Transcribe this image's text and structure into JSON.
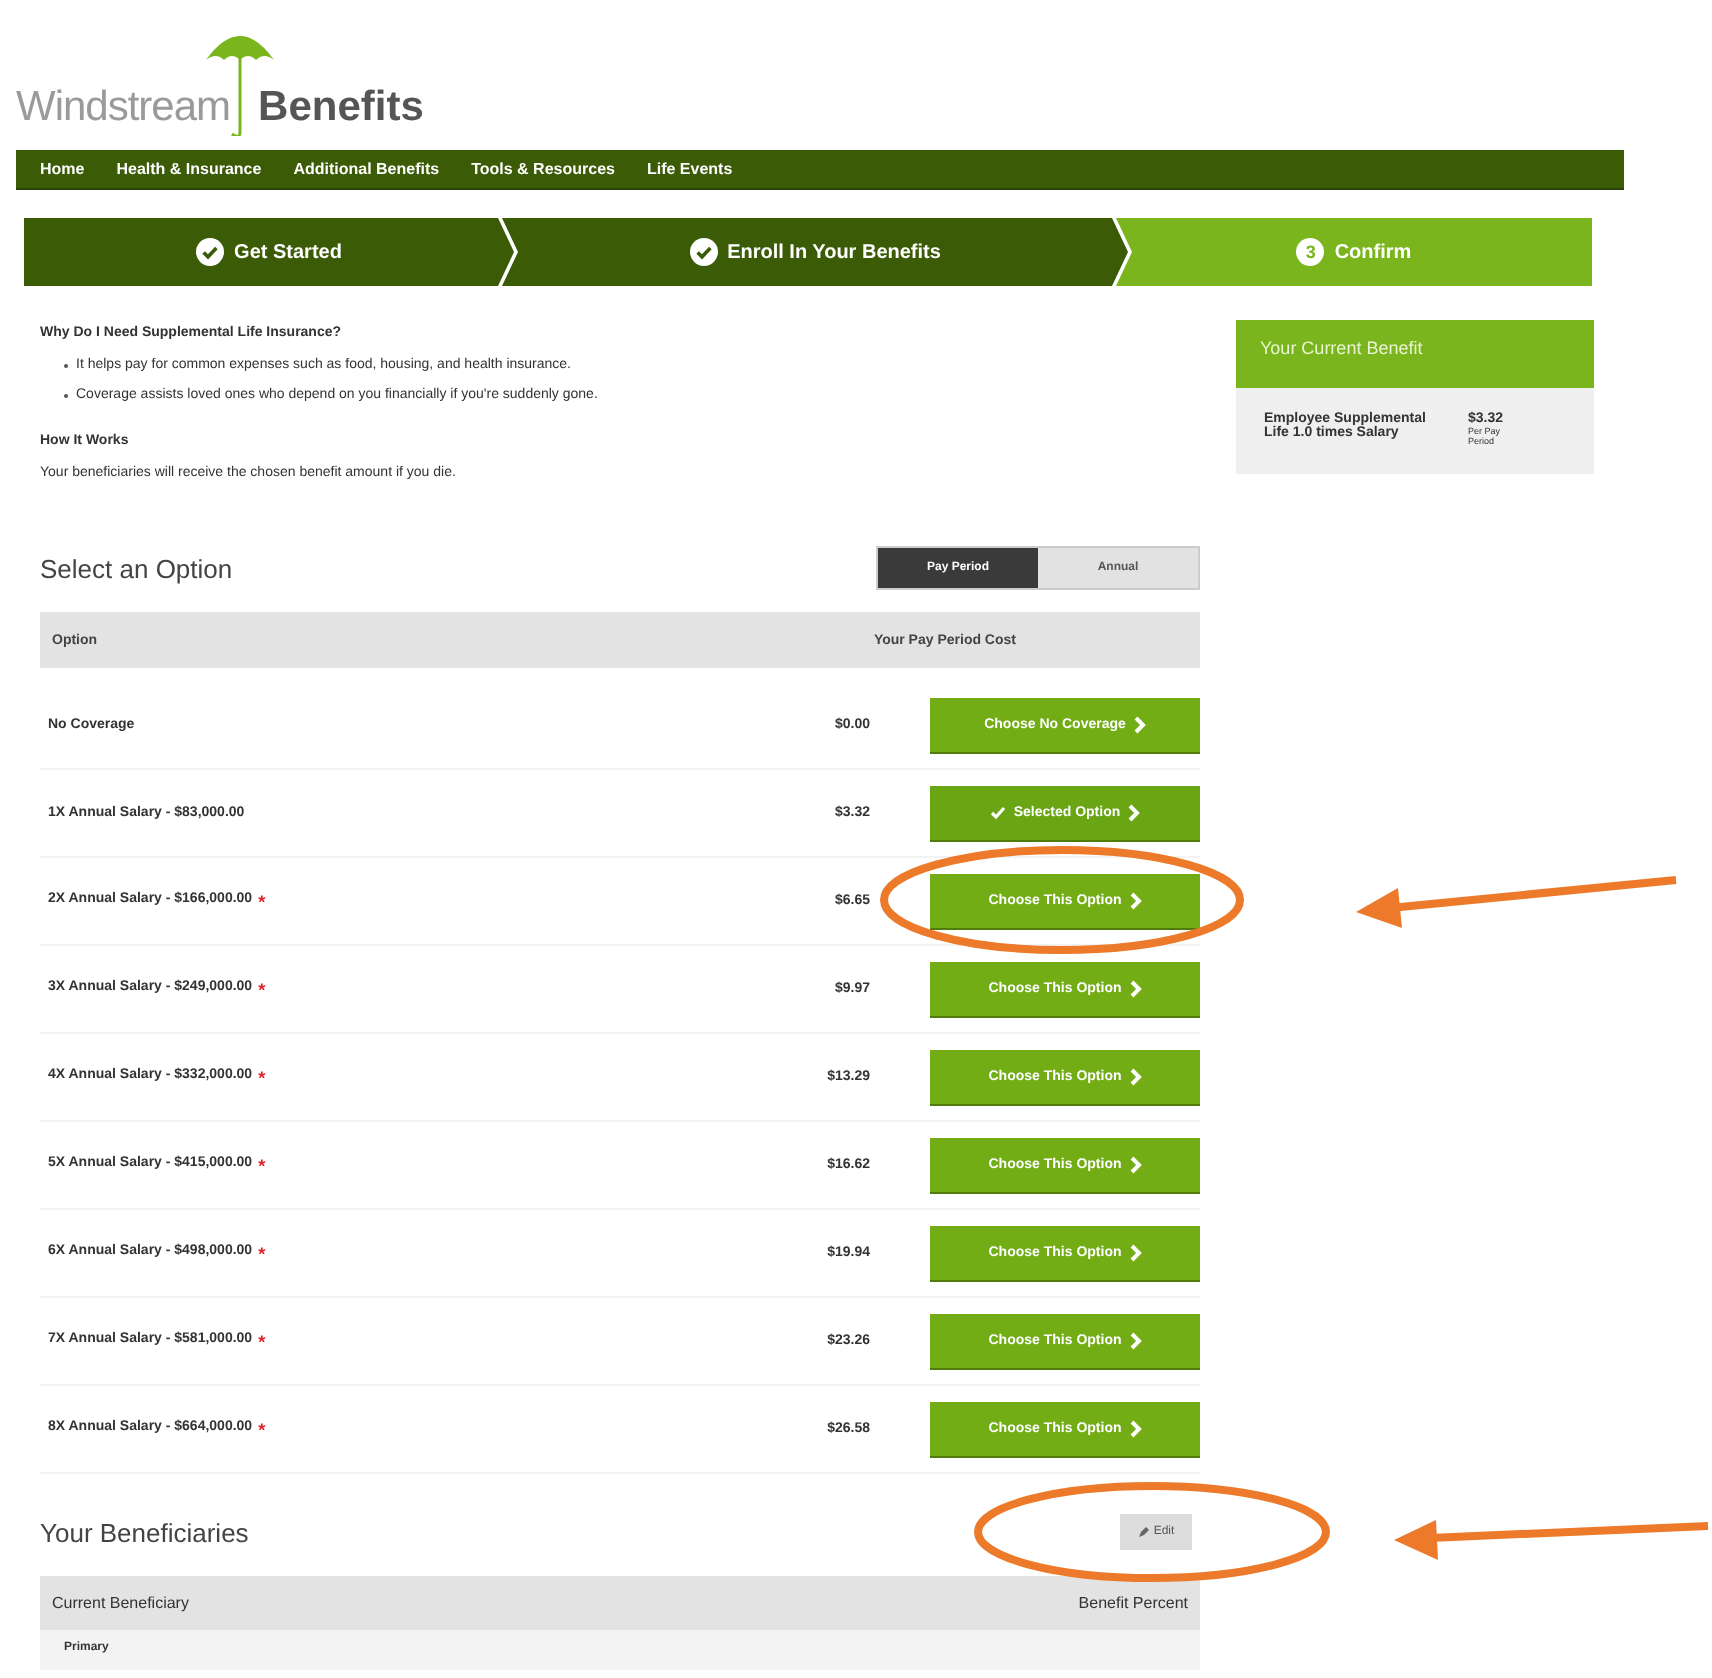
{
  "logo": {
    "light": "Windstream",
    "bold": "Benefits"
  },
  "nav": [
    "Home",
    "Health & Insurance",
    "Additional Benefits",
    "Tools & Resources",
    "Life Events"
  ],
  "steps": [
    {
      "label": "Get Started",
      "completed": true
    },
    {
      "label": "Enroll In Your Benefits",
      "completed": true
    },
    {
      "label": "Confirm",
      "completed": false,
      "number": "3"
    }
  ],
  "intro": {
    "title": "Why Do I Need Supplemental Life Insurance?",
    "bullets": [
      "It helps pay for common expenses such as food, housing, and health insurance.",
      "Coverage assists loved ones who depend on you financially if you're suddenly gone."
    ],
    "how_title": "How It Works",
    "how_text": "Your beneficiaries will receive the chosen benefit amount if you die."
  },
  "current_benefit": {
    "title": "Your Current Benefit",
    "name": "Employee Supplemental Life 1.0 times Salary",
    "cost": "$3.32",
    "period": "Per Pay Period"
  },
  "options": {
    "title": "Select an Option",
    "toggle": [
      {
        "label": "Pay Period",
        "selected": true
      },
      {
        "label": "Annual",
        "selected": false
      }
    ],
    "columns": [
      "Option",
      "Your Pay Period Cost"
    ],
    "rows": [
      {
        "label": "No Coverage",
        "cost": "$0.00",
        "button": "Choose No Coverage",
        "selected": false
      },
      {
        "label": "1X Annual Salary - $83,000.00",
        "cost": "$3.32",
        "button": "Selected Option",
        "selected": true
      },
      {
        "label": "2X Annual Salary - $166,000.00",
        "cost": "$6.65",
        "button": "Choose This Option",
        "selected": false,
        "mark": "*"
      },
      {
        "label": "3X Annual Salary - $249,000.00",
        "cost": "$9.97",
        "button": "Choose This Option",
        "selected": false,
        "mark": "*"
      },
      {
        "label": "4X Annual Salary - $332,000.00",
        "cost": "$13.29",
        "button": "Choose This Option",
        "selected": false,
        "mark": "*"
      },
      {
        "label": "5X Annual Salary - $415,000.00",
        "cost": "$16.62",
        "button": "Choose This Option",
        "selected": false,
        "mark": "*"
      },
      {
        "label": "6X Annual Salary - $498,000.00",
        "cost": "$19.94",
        "button": "Choose This Option",
        "selected": false,
        "mark": "*"
      },
      {
        "label": "7X Annual Salary - $581,000.00",
        "cost": "$23.26",
        "button": "Choose This Option",
        "selected": false,
        "mark": "*"
      },
      {
        "label": "8X Annual Salary - $664,000.00",
        "cost": "$26.58",
        "button": "Choose This Option",
        "selected": false,
        "mark": "*"
      }
    ]
  },
  "beneficiaries": {
    "title": "Your Beneficiaries",
    "edit": "Edit",
    "columns": [
      "Current Beneficiary",
      "Benefit Percent"
    ],
    "group": "Primary"
  }
}
